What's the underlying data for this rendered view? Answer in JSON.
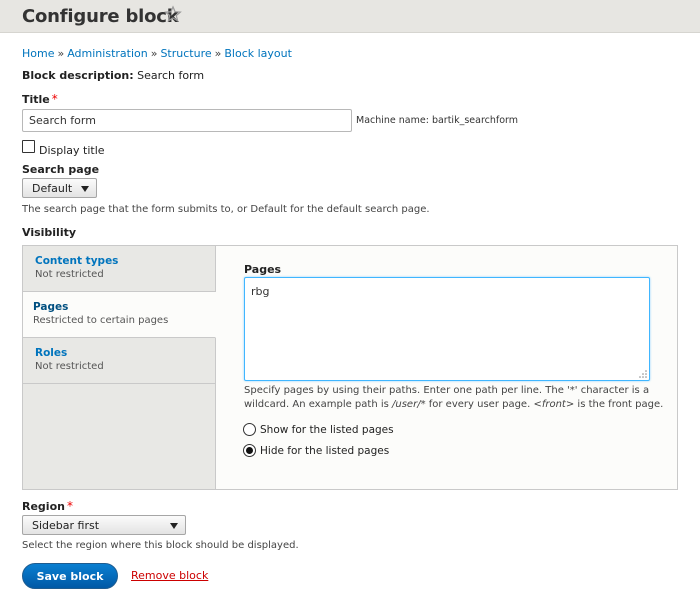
{
  "header": {
    "title": "Configure block",
    "shortcut_icon": "star-outline-icon"
  },
  "breadcrumb": [
    "Home",
    "Administration",
    "Structure",
    "Block layout"
  ],
  "breadcrumb_separator": "»",
  "block_description": {
    "label": "Block description:",
    "value": "Search form"
  },
  "title_field": {
    "label": "Title",
    "required_mark": "*",
    "value": "Search form",
    "machine_name": "Machine name: bartik_searchform"
  },
  "display_title": {
    "label": "Display title",
    "checked": false
  },
  "search_page": {
    "label": "Search page",
    "selected": "Default",
    "help": "The search page that the form submits to, or Default for the default search page."
  },
  "visibility": {
    "label": "Visibility",
    "tabs": [
      {
        "title": "Content types",
        "summary": "Not restricted"
      },
      {
        "title": "Pages",
        "summary": "Restricted to certain pages"
      },
      {
        "title": "Roles",
        "summary": "Not restricted"
      }
    ],
    "pages": {
      "label": "Pages",
      "value": "rbg",
      "help_1": "Specify pages by using their paths. Enter one path per line. The '*' character is a wildcard. An example path is ",
      "help_path": "/user/*",
      "help_2": " for every user page. ",
      "help_front": "<front>",
      "help_3": " is the front page.",
      "radio_show": "Show for the listed pages",
      "radio_hide": "Hide for the listed pages",
      "selected_radio": "hide"
    }
  },
  "region": {
    "label": "Region",
    "required_mark": "*",
    "selected": "Sidebar first",
    "help": "Select the region where this block should be displayed."
  },
  "actions": {
    "save_label": "Save block",
    "remove_label": "Remove block"
  },
  "colors": {
    "link": "#0074bd",
    "button": "#0069b9",
    "remove": "#cc0000",
    "required": "#ee0000",
    "focus": "#40b6ff"
  }
}
